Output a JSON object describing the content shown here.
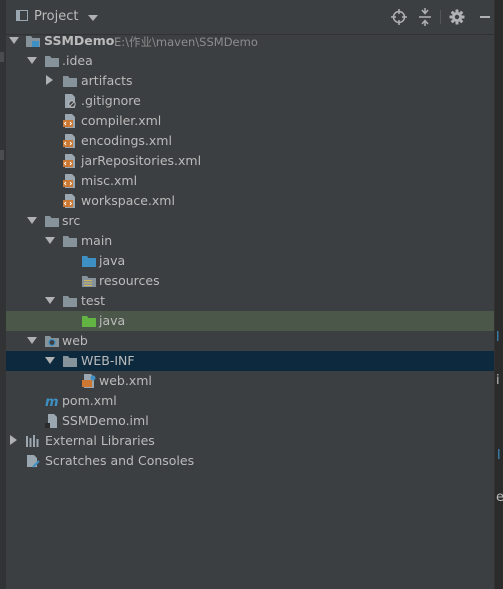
{
  "header": {
    "title": "Project"
  },
  "tree": {
    "root": {
      "label": "SSMDemo",
      "path": "E:\\作业\\maven\\SSMDemo"
    },
    "idea": {
      "label": ".idea"
    },
    "artifacts": {
      "label": "artifacts"
    },
    "gitignore": {
      "label": ".gitignore"
    },
    "compiler": {
      "label": "compiler.xml"
    },
    "encodings": {
      "label": "encodings.xml"
    },
    "jarrepos": {
      "label": "jarRepositories.xml"
    },
    "misc": {
      "label": "misc.xml"
    },
    "workspace": {
      "label": "workspace.xml"
    },
    "src": {
      "label": "src"
    },
    "main": {
      "label": "main"
    },
    "main_java": {
      "label": "java"
    },
    "resources": {
      "label": "resources"
    },
    "test": {
      "label": "test"
    },
    "test_java": {
      "label": "java"
    },
    "web": {
      "label": "web"
    },
    "webinf": {
      "label": "WEB-INF"
    },
    "webxml": {
      "label": "web.xml"
    },
    "pom": {
      "label": "pom.xml"
    },
    "iml": {
      "label": "SSMDemo.iml"
    },
    "extlibs": {
      "label": "External Libraries"
    },
    "scratches": {
      "label": "Scratches and Consoles"
    }
  },
  "colors": {
    "background": "#3c3f41",
    "text": "#bbbbbb",
    "folder": "#87939a",
    "source_folder": "#3d8fc4",
    "test_folder": "#62b543",
    "xml_icon": "#cc7832",
    "selection_inactive": "#4b5749",
    "selection_active": "#0d293e"
  }
}
